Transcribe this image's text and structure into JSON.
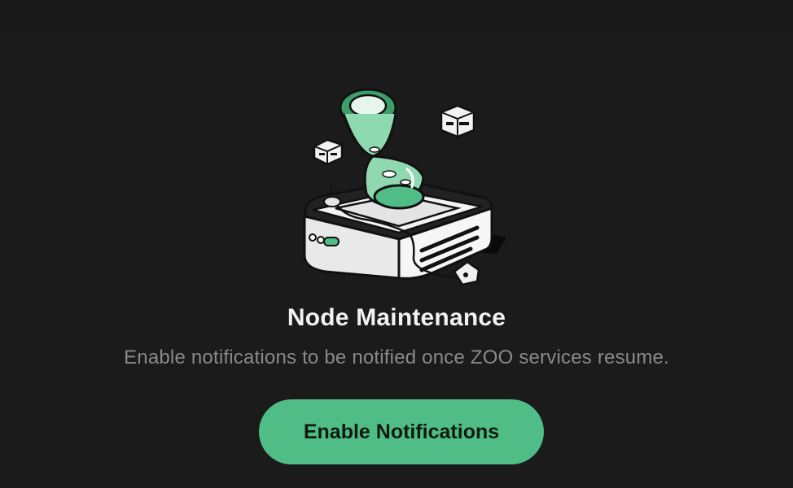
{
  "empty_state": {
    "title": "Node Maintenance",
    "message": "Enable notifications to be notified once ZOO services resume.",
    "illustration": "node-maintenance-hourglass-illustration"
  },
  "actions": {
    "enable_notifications_label": "Enable Notifications"
  },
  "colors": {
    "background": "#1b1b1b",
    "accent": "#4fbd85",
    "title": "#f2f2f2",
    "message": "#8a8a8a"
  }
}
